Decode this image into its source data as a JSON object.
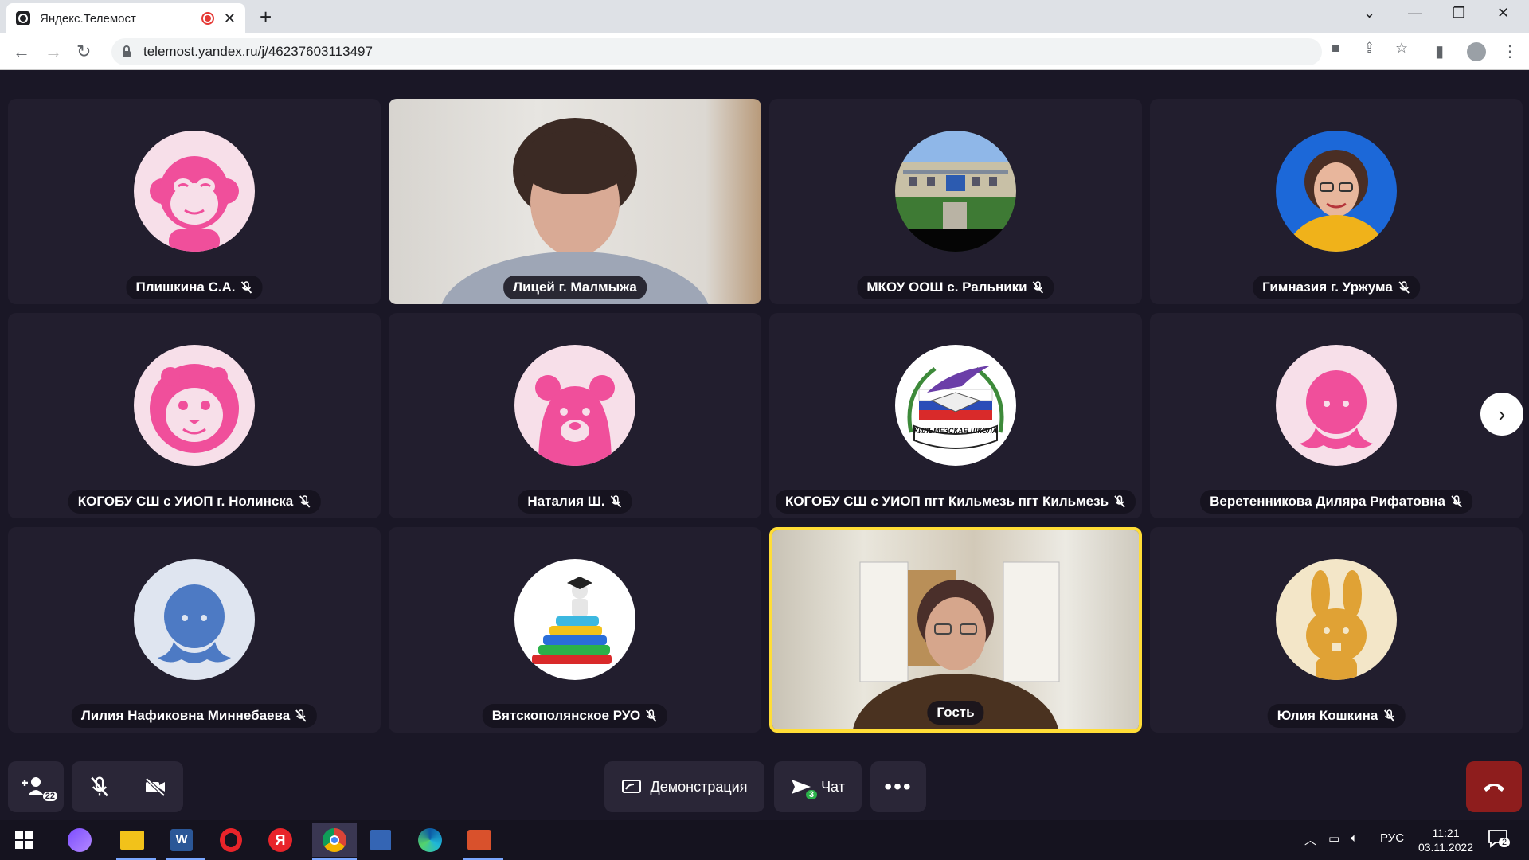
{
  "browser": {
    "tab_title": "Яндекс.Телемост",
    "url": "telemost.yandex.ru/j/46237603113497"
  },
  "participants": [
    {
      "name": "Плишкина С.А.",
      "muted": true,
      "kind": "monkey-avatar"
    },
    {
      "name": "Лицей г. Малмыжа",
      "muted": false,
      "kind": "video"
    },
    {
      "name": "МКОУ ООШ с. Ральники",
      "muted": true,
      "kind": "school-photo"
    },
    {
      "name": "Гимназия г. Уржума",
      "muted": true,
      "kind": "portrait"
    },
    {
      "name": "КОГОБУ СШ с УИОП г. Нолинска",
      "muted": true,
      "kind": "lion-avatar"
    },
    {
      "name": "Наталия Ш.",
      "muted": true,
      "kind": "bear-avatar"
    },
    {
      "name": "КОГОБУ СШ с УИОП пгт Кильмезь пгт Кильмезь",
      "muted": true,
      "kind": "school-logo"
    },
    {
      "name": "Веретенникова Диляра Рифатовна",
      "muted": true,
      "kind": "octopus-avatar"
    },
    {
      "name": "Лилия Нафиковна Миннебаева",
      "muted": true,
      "kind": "octopus-blue-avatar"
    },
    {
      "name": "Вятскополянское РУО",
      "muted": true,
      "kind": "books-avatar"
    },
    {
      "name": "Гость",
      "muted": false,
      "kind": "video-active"
    },
    {
      "name": "Юлия Кошкина",
      "muted": true,
      "kind": "rabbit-avatar"
    }
  ],
  "logo_text": "КИЛЬМЕЗСКАЯ ШКОЛА",
  "controls": {
    "participants_count": "22",
    "screen_share_label": "Демонстрация",
    "chat_label": "Чат",
    "chat_badge": "3"
  },
  "taskbar": {
    "language": "РУС",
    "time": "11:21",
    "date": "03.11.2022",
    "notifications": "2"
  },
  "colors": {
    "background": "#1a1726",
    "tile": "#221e2e",
    "active_border": "#ffdd36",
    "avatar_pink": "#f04f9b",
    "hangup": "#8e1d1d"
  }
}
